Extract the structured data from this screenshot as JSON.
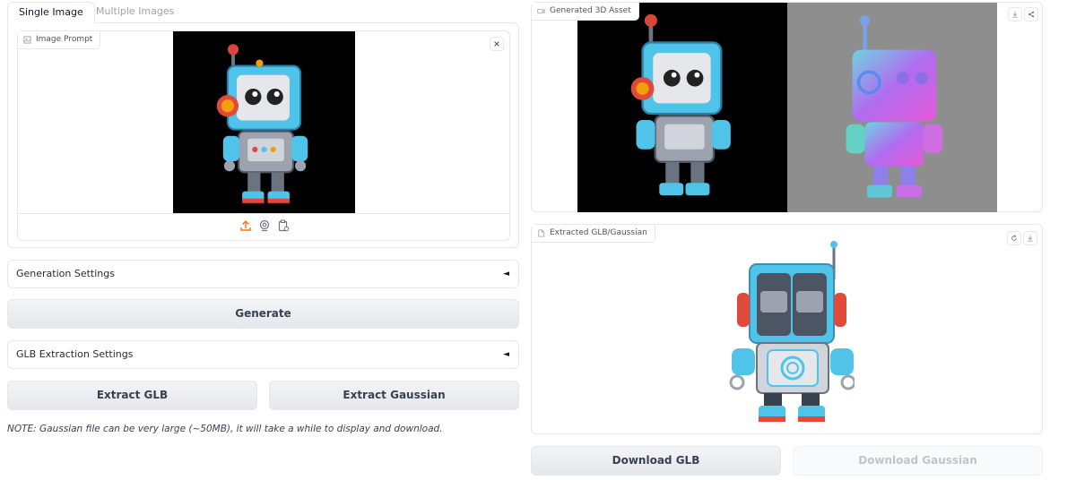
{
  "tabs": [
    {
      "label": "Single Image",
      "active": true
    },
    {
      "label": "Multiple Images",
      "active": false
    }
  ],
  "image_prompt": {
    "label": "Image Prompt",
    "label_icon": "image-icon",
    "close_icon": "close-icon",
    "toolbar_icons": [
      "upload-icon",
      "webcam-icon",
      "clipboard-icon"
    ]
  },
  "generation_settings": {
    "label": "Generation Settings",
    "caret": "◄"
  },
  "generate_button": {
    "label": "Generate"
  },
  "glb_settings": {
    "label": "GLB Extraction Settings",
    "caret": "◄"
  },
  "extract_glb_button": {
    "label": "Extract GLB"
  },
  "extract_gaussian_button": {
    "label": "Extract Gaussian"
  },
  "note": "NOTE: Gaussian file can be very large (~50MB), it will take a while to display and download.",
  "generated_asset": {
    "label": "Generated 3D Asset",
    "label_icon": "video-icon",
    "actions": [
      "download-icon",
      "share-icon"
    ]
  },
  "extracted": {
    "label": "Extracted GLB/Gaussian",
    "label_icon": "file-icon",
    "actions": [
      "reset-icon",
      "download-icon"
    ]
  },
  "download_glb_button": {
    "label": "Download GLB"
  },
  "download_gaussian_button": {
    "label": "Download Gaussian",
    "enabled": false
  },
  "colors": {
    "accent_orange": "#f97316",
    "border": "#e5e7eb",
    "robot_cyan": "#4fc3e8",
    "robot_red": "#e04a3a",
    "normal_map_bg": "#8e8e8e"
  }
}
